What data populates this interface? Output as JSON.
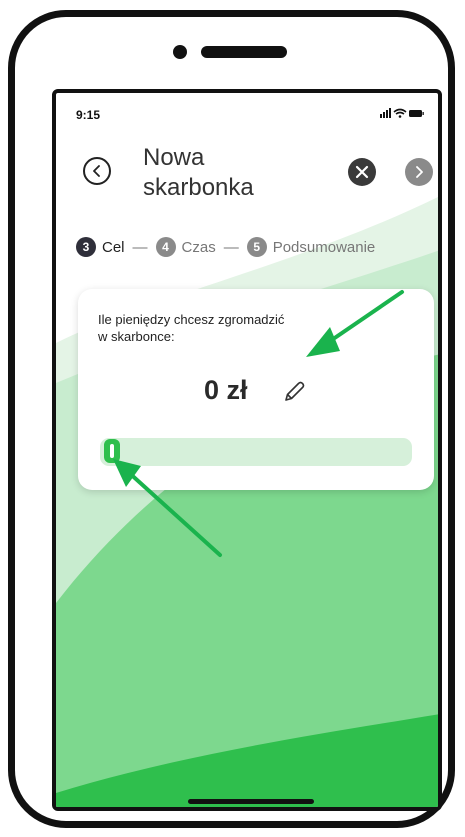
{
  "status_bar": {
    "time": "9:15"
  },
  "header": {
    "title_line1": "Nowa",
    "title_line2": "skarbonka"
  },
  "steps": [
    {
      "number": "3",
      "label": "Cel"
    },
    {
      "number": "4",
      "label": "Czas"
    },
    {
      "number": "5",
      "label": "Podsumowanie"
    }
  ],
  "step_separator": "—",
  "card": {
    "question_line1": "Ile pieniędzy chcesz zgromadzić",
    "question_line2": "w skarbonce:",
    "amount": "0 zł",
    "slider_level": 0
  },
  "colors": {
    "accent_green": "#2fbf4d",
    "annotation_arrow": "#1ab34d"
  },
  "icons": [
    "back-icon",
    "close-icon",
    "chevron-right-icon",
    "edit-pencil-icon",
    "signal-icon",
    "wifi-icon",
    "battery-icon"
  ]
}
